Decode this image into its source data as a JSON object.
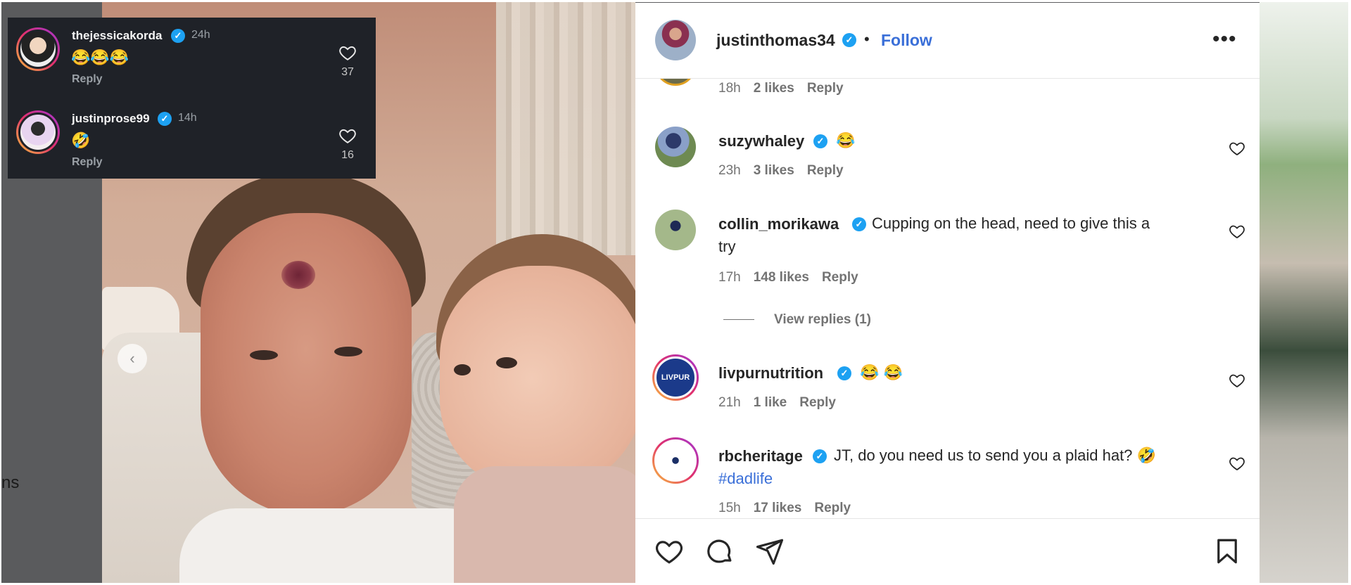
{
  "left_strip": {
    "cut_text": "ns"
  },
  "overlay": {
    "comments": [
      {
        "user": "thejessicakorda",
        "time": "24h",
        "text": "😂😂😂",
        "reply": "Reply",
        "likes": "37"
      },
      {
        "user": "justinprose99",
        "time": "14h",
        "text": "🤣",
        "reply": "Reply",
        "likes": "16"
      }
    ]
  },
  "post": {
    "header": {
      "username": "justinthomas34",
      "separator": "•",
      "follow": "Follow",
      "more": "•••"
    },
    "comments": [
      {
        "id": "partial",
        "time": "18h",
        "likes": "2 likes",
        "reply": "Reply"
      },
      {
        "id": "suzy",
        "user": "suzywhaley",
        "text": "😂",
        "time": "23h",
        "likes": "3 likes",
        "reply": "Reply"
      },
      {
        "id": "collin",
        "user": "collin_morikawa",
        "text_line1": "Cupping on the head, need to give this a",
        "text_line2": "try",
        "time": "17h",
        "likes": "148 likes",
        "reply": "Reply",
        "view_replies": "View replies (1)"
      },
      {
        "id": "livpur",
        "user": "livpurnutrition",
        "text": "😂 😂",
        "avatar_text": "LIVPUR",
        "time": "21h",
        "likes": "1 like",
        "reply": "Reply"
      },
      {
        "id": "rbc",
        "user": "rbcheritage",
        "text_line1": "JT, do you need us to send you a plaid hat? 🤣",
        "hashtag": "#dadlife",
        "time": "15h",
        "likes": "17 likes",
        "reply": "Reply"
      }
    ],
    "actions": [
      "like-icon",
      "comment-icon",
      "share-icon",
      "save-icon"
    ]
  },
  "colors": {
    "follow": "#3a6fd8",
    "verified": "#1da1f2",
    "overlay_bg": "#1f2228"
  }
}
